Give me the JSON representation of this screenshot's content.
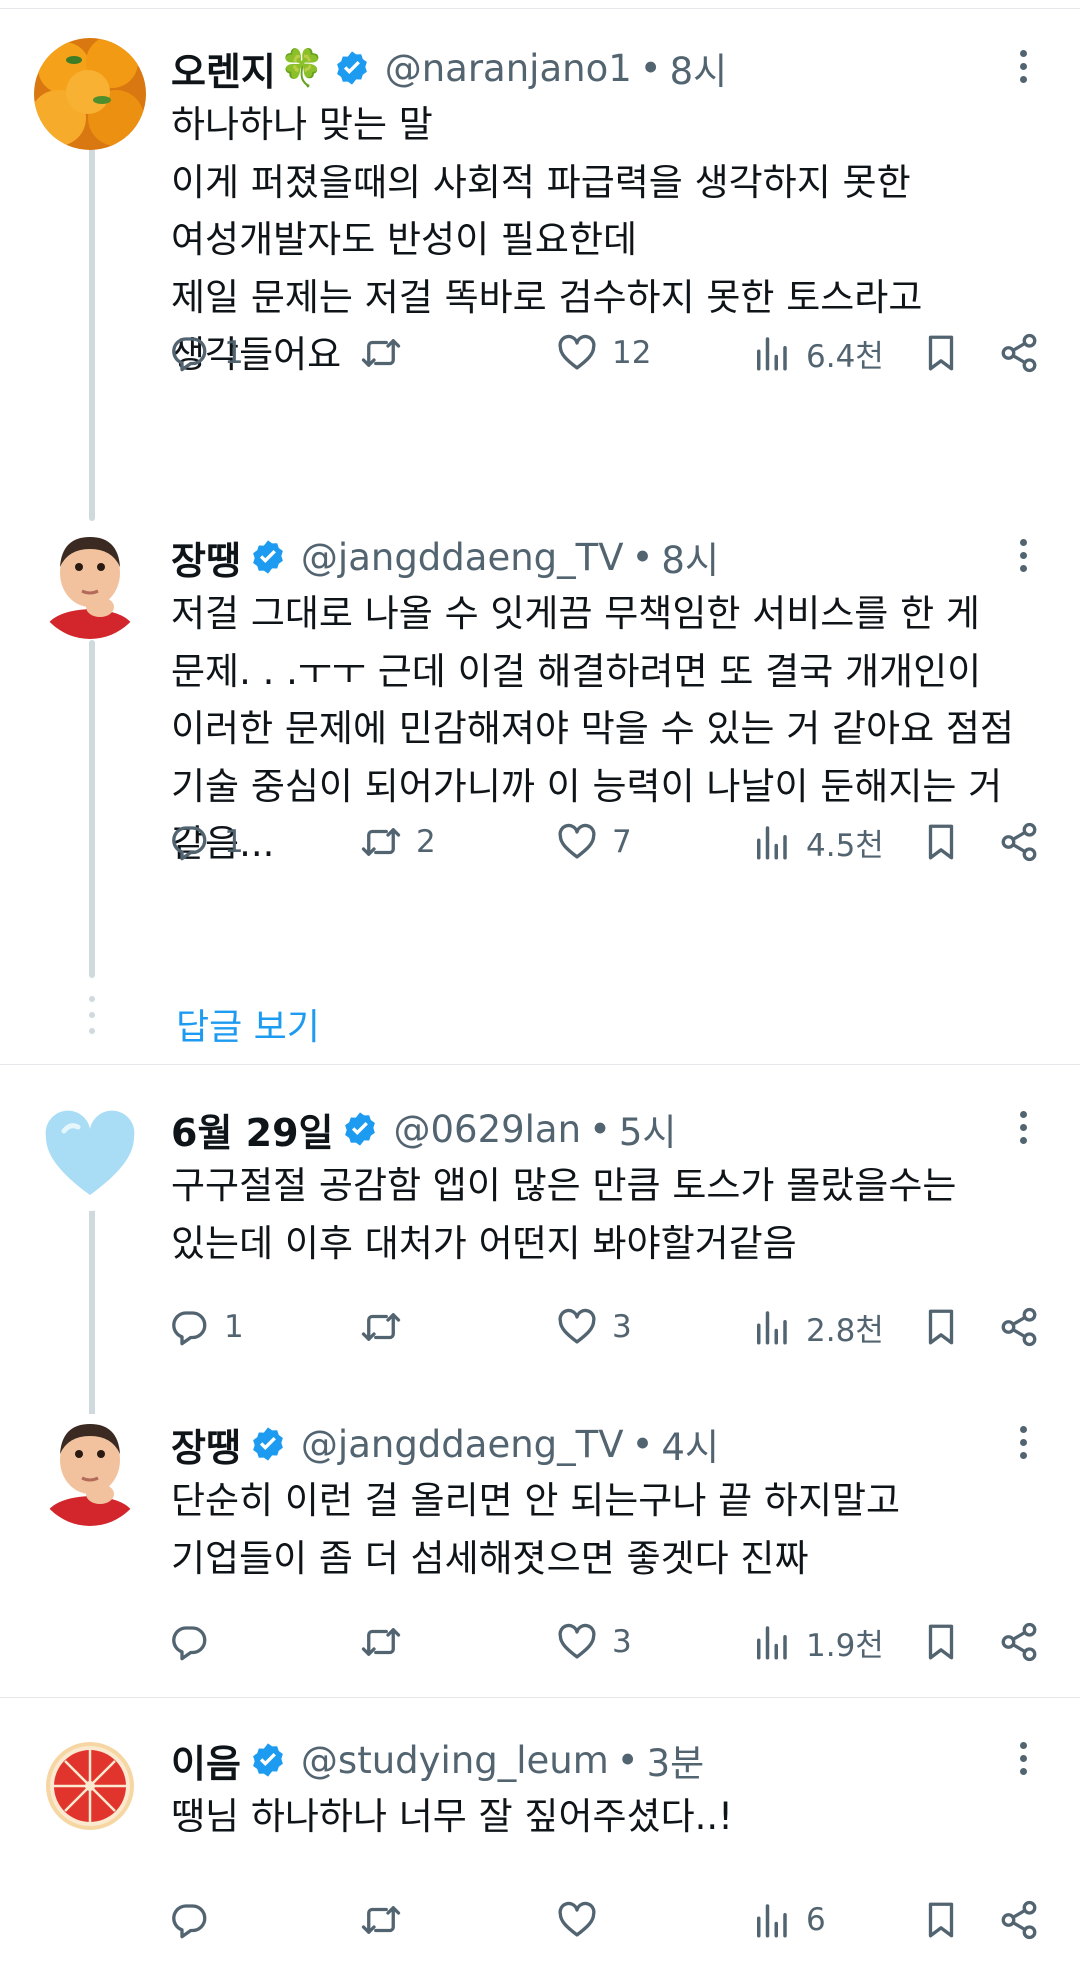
{
  "tweets": [
    {
      "name": "오렌지",
      "emoji": "🍀",
      "handle": "@naranjano1",
      "time": "8시",
      "text": "하나하나 맞는 말\n이게 퍼졌을때의 사회적 파급력을 생각하지 못한\n여성개발자도 반성이 필요한데\n제일 문제는 저걸 똑바로 검수하지 못한 토스라고\n생각들어요",
      "replies": "1",
      "retweets": "",
      "likes": "12",
      "views": "6.4천",
      "avatar": "orange-avatar"
    },
    {
      "name": "장땡",
      "handle": "@jangddaeng_TV",
      "time": "8시",
      "text": "저걸 그대로 나올 수 잇게끔 무책임한 서비스를 한 게\n문제. . .ㅜㅜ 근데 이걸 해결하려면 또 결국 개개인이\n이러한 문제에 민감해져야 막을 수 있는 거 같아요 점점\n기술 중심이 되어가니까 이 능력이 나날이 둔해지는 거\n같음...",
      "replies": "1",
      "retweets": "2",
      "likes": "7",
      "views": "4.5천",
      "avatar": "kid-avatar"
    },
    {
      "name": "6월 29일",
      "handle": "@0629lan",
      "time": "5시",
      "text": "구구절절 공감함 앱이 많은 만큼 토스가 몰랐을수는\n있는데 이후 대처가 어떤지 봐야할거같음",
      "replies": "1",
      "retweets": "",
      "likes": "3",
      "views": "2.8천",
      "avatar": "heart-avatar"
    },
    {
      "name": "장땡",
      "handle": "@jangddaeng_TV",
      "time": "4시",
      "text": "단순히 이런 걸 올리면 안 되는구나 끝 하지말고\n기업들이 좀 더 섬세해졋으면 좋겟다 진짜",
      "replies": "",
      "retweets": "",
      "likes": "3",
      "views": "1.9천",
      "avatar": "kid-avatar"
    },
    {
      "name": "이음",
      "handle": "@studying_leum",
      "time": "3분",
      "text": "땡님 하나하나 너무 잘 짚어주셨다..!",
      "replies": "",
      "retweets": "",
      "likes": "",
      "views": "6",
      "avatar": "grapefruit-avatar"
    }
  ],
  "show_replies_label": "답글 보기",
  "dot_separator": "•",
  "colors": {
    "verified": "#1d9bf0",
    "link": "#1d9bf0",
    "muted": "#536471",
    "thread": "#cfd9de"
  },
  "icons": [
    "reply-icon",
    "retweet-icon",
    "like-icon",
    "views-icon",
    "bookmark-icon",
    "share-icon",
    "more-icon",
    "verified-badge-icon"
  ]
}
